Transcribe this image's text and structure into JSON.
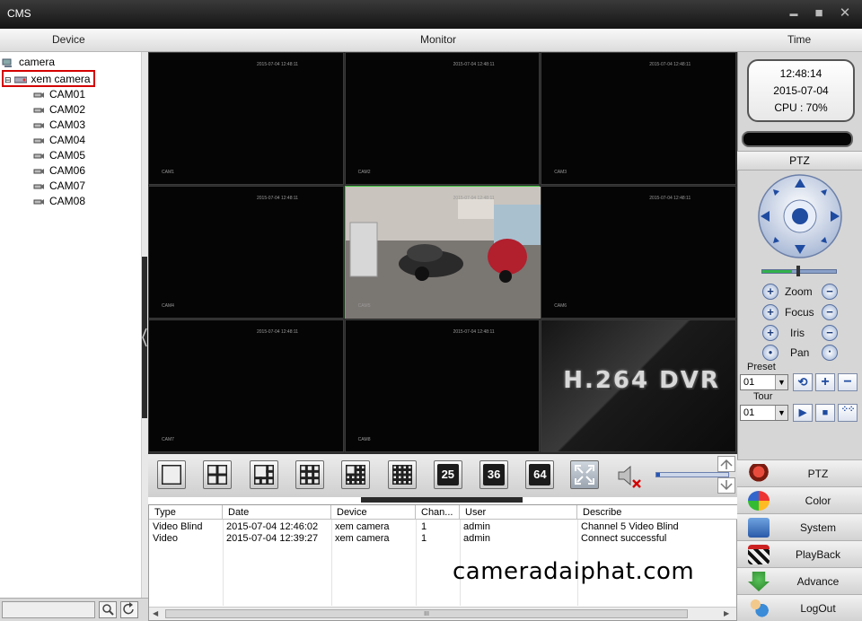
{
  "window": {
    "title": "CMS",
    "minimize": "▬",
    "maximize": "■",
    "close": "✕"
  },
  "header": {
    "device": "Device",
    "monitor": "Monitor",
    "time": "Time"
  },
  "tree": {
    "root": "camera",
    "group": "xem camera",
    "expander": "⊟",
    "cams": [
      "CAM01",
      "CAM02",
      "CAM03",
      "CAM04",
      "CAM05",
      "CAM06",
      "CAM07",
      "CAM08"
    ]
  },
  "grid": {
    "timestamp": "2015-07-04 12:48:11",
    "cells": [
      {
        "label": "CAM1"
      },
      {
        "label": "CAM2"
      },
      {
        "label": "CAM3"
      },
      {
        "label": "CAM4"
      },
      {
        "label": "CAM5"
      },
      {
        "label": "CAM6"
      },
      {
        "label": "CAM7"
      },
      {
        "label": "CAM8"
      },
      {
        "label": ""
      }
    ],
    "dvr_logo": "H.264 DVR"
  },
  "toolbar": {
    "layouts": [
      "1",
      "4",
      "6",
      "9",
      "10",
      "16",
      "25",
      "36",
      "64"
    ],
    "fullscreen_icon": "fullscreen-icon",
    "mute_icon": "speaker-muted-icon",
    "volume": 0.05
  },
  "log": {
    "columns": [
      "Type",
      "Date",
      "Device",
      "Chan...",
      "User",
      "Describe"
    ],
    "rows": [
      [
        "Video Blind",
        "2015-07-04 12:46:02",
        "xem camera",
        "1",
        "admin",
        "Channel 5 Video Blind"
      ],
      [
        "Video",
        "2015-07-04 12:39:27",
        "xem camera",
        "1",
        "admin",
        "Connect successful"
      ]
    ],
    "scroll_grip": "III"
  },
  "watermark": "cameradaiphat.com",
  "time": {
    "clock": "12:48:14",
    "date": "2015-07-04",
    "cpu": "CPU : 70%"
  },
  "ptz": {
    "title": "PTZ",
    "zoom": "Zoom",
    "focus": "Focus",
    "iris": "Iris",
    "pan": "Pan",
    "plus": "+",
    "minus": "−",
    "preset_label": "Preset",
    "preset_value": "01",
    "tour_label": "Tour",
    "tour_value": "01",
    "speed": 0.4
  },
  "menu": [
    {
      "label": "PTZ"
    },
    {
      "label": "Color"
    },
    {
      "label": "System"
    },
    {
      "label": "PlayBack"
    },
    {
      "label": "Advance"
    },
    {
      "label": "LogOut"
    }
  ],
  "colors": {
    "active_cell": "#3dc43d",
    "highlight": "#d40000",
    "accent": "#1f4ba0"
  }
}
